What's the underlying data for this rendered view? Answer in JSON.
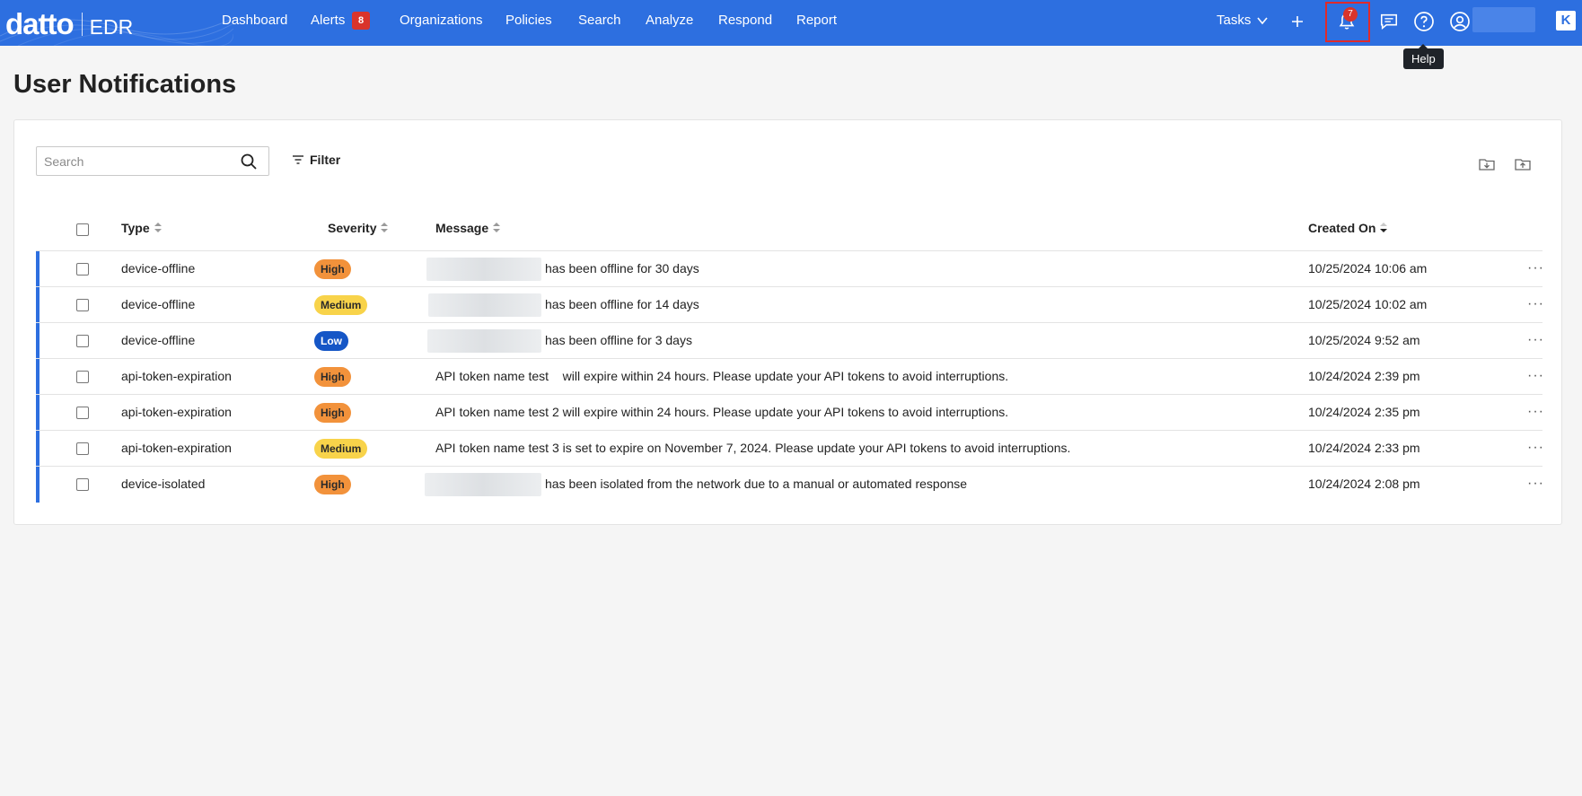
{
  "brand": {
    "name": "datto",
    "product": "EDR"
  },
  "nav": {
    "items": [
      "Dashboard",
      "Alerts",
      "Organizations",
      "Policies",
      "Search",
      "Analyze",
      "Respond",
      "Report"
    ],
    "alerts_badge": "8",
    "tasks_label": "Tasks",
    "notifications_badge": "7",
    "tooltip": "Help"
  },
  "page": {
    "title": "User Notifications"
  },
  "toolbar": {
    "search_placeholder": "Search",
    "filter_label": "Filter"
  },
  "table": {
    "headers": {
      "type": "Type",
      "severity": "Severity",
      "message": "Message",
      "created_on": "Created On"
    },
    "rows": [
      {
        "type": "device-offline",
        "severity": "High",
        "message": "has been offline for 30 days",
        "created_on": "10/25/2024 10:06 am"
      },
      {
        "type": "device-offline",
        "severity": "Medium",
        "message": "has been offline for 14 days",
        "created_on": "10/25/2024 10:02 am"
      },
      {
        "type": "device-offline",
        "severity": "Low",
        "message": "has been offline for 3 days",
        "created_on": "10/25/2024 9:52 am"
      },
      {
        "type": "api-token-expiration",
        "severity": "High",
        "message": "API token name test    will expire within 24 hours. Please update your API tokens to avoid interruptions.",
        "created_on": "10/24/2024 2:39 pm"
      },
      {
        "type": "api-token-expiration",
        "severity": "High",
        "message": "API token name test 2 will expire within 24 hours. Please update your API tokens to avoid interruptions.",
        "created_on": "10/24/2024 2:35 pm"
      },
      {
        "type": "api-token-expiration",
        "severity": "Medium",
        "message": "API token name test 3 is set to expire on November 7, 2024. Please update your API tokens to avoid interruptions.",
        "created_on": "10/24/2024 2:33 pm"
      },
      {
        "type": "device-isolated",
        "severity": "High",
        "message": "has been isolated from the network due to a manual or automated response",
        "created_on": "10/24/2024 2:08 pm"
      }
    ],
    "row_action": "···"
  },
  "colors": {
    "nav_bg": "#2d6fe0",
    "row_accent": "#2d6fe0",
    "high": "#f2923b",
    "medium": "#f8d34a",
    "low": "#1556c6"
  }
}
